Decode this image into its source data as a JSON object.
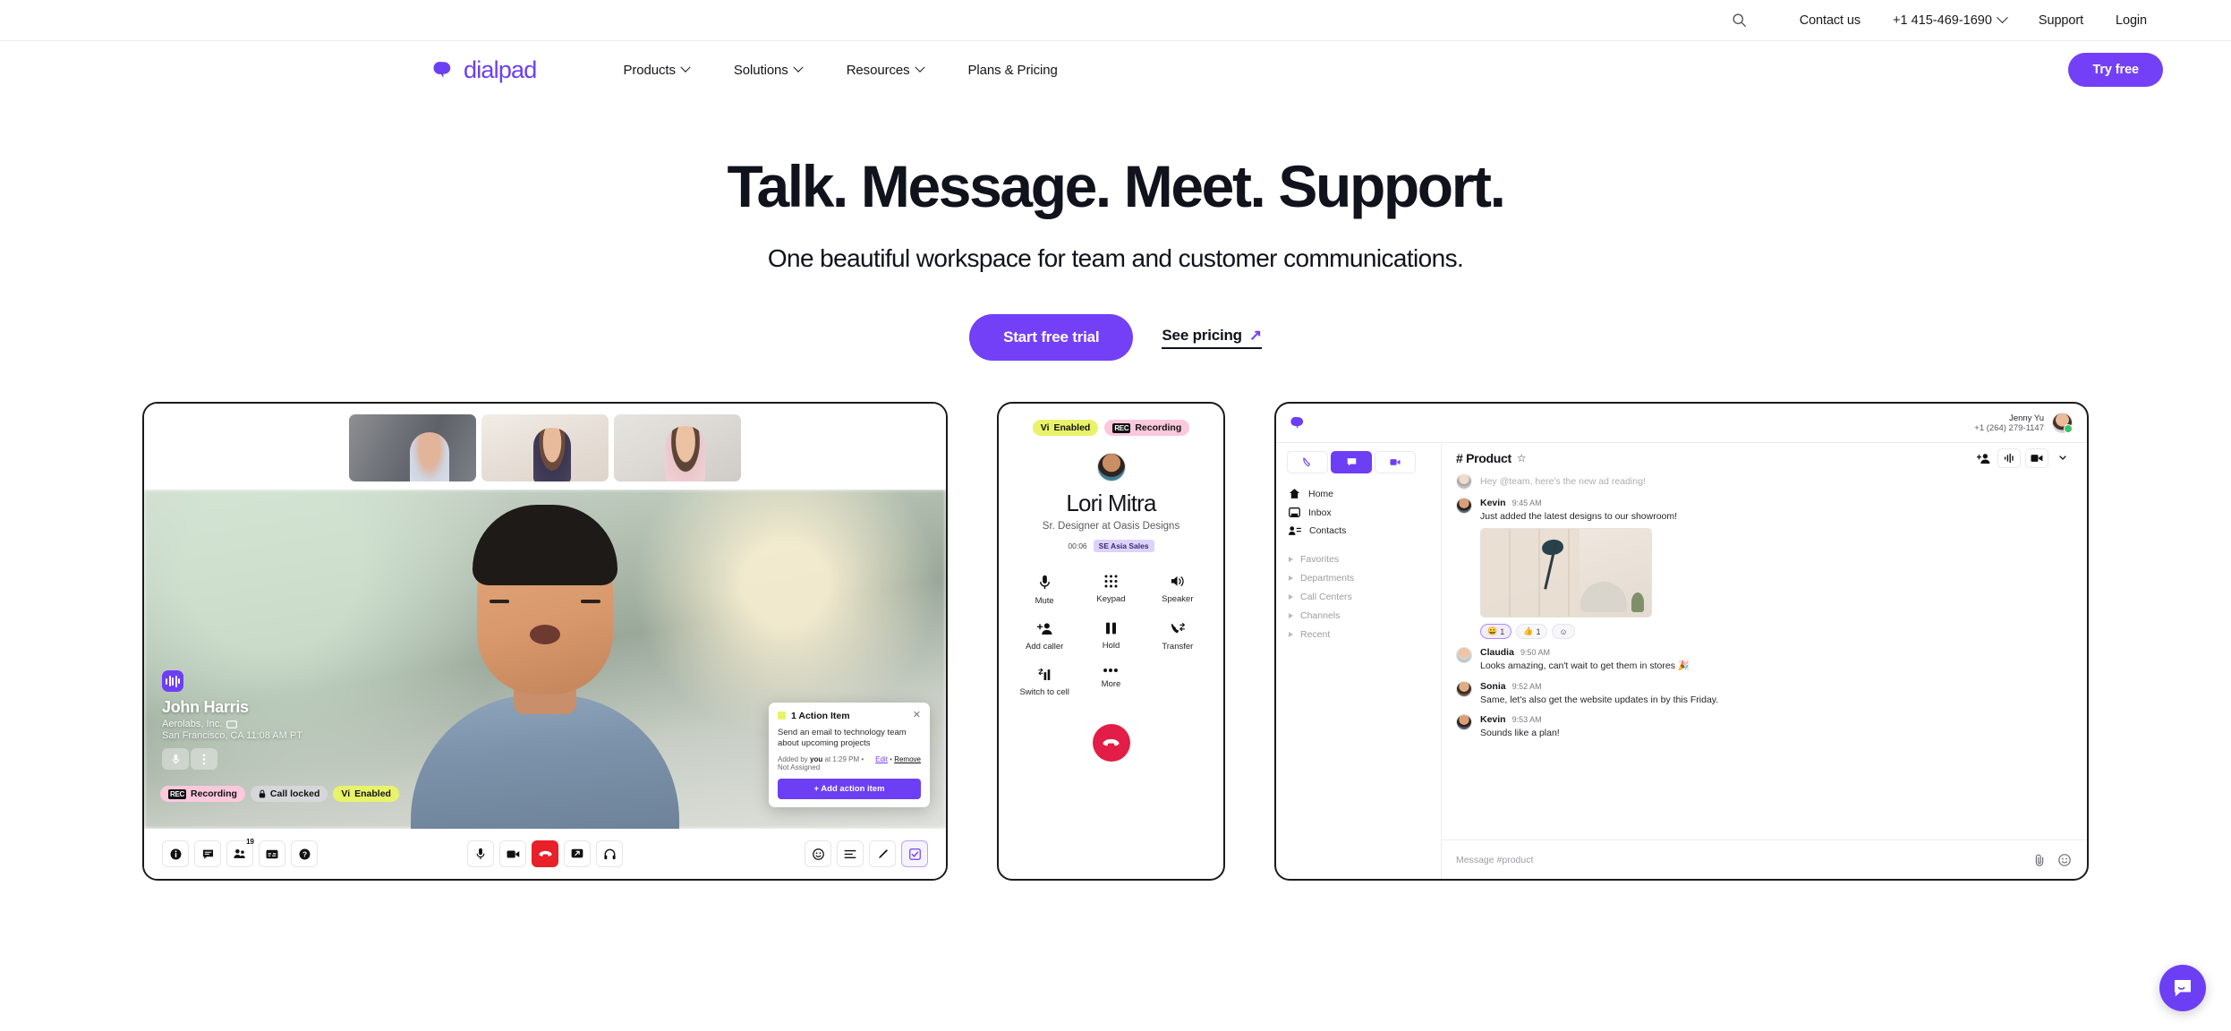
{
  "utility_bar": {
    "search_icon": "search-icon",
    "links": [
      {
        "label": "Contact us"
      },
      {
        "label": "Support"
      },
      {
        "label": "Login"
      }
    ],
    "phone": "+1 415-469-1690"
  },
  "nav": {
    "logo_text": "dialpad",
    "items": [
      {
        "label": "Products",
        "has_caret": true
      },
      {
        "label": "Solutions",
        "has_caret": true
      },
      {
        "label": "Resources",
        "has_caret": true
      },
      {
        "label": "Plans & Pricing",
        "has_caret": false
      }
    ],
    "cta": "Try free"
  },
  "hero": {
    "headline": "Talk. Message. Meet. Support.",
    "subhead": "One beautiful workspace for team and customer communications.",
    "primary_cta": "Start free trial",
    "secondary_cta": "See pricing",
    "secondary_arrow": "↗"
  },
  "meeting_card": {
    "participant_name": "John Harris",
    "participant_company": "Aerolabs, Inc.",
    "participant_location": "San Francisco, CA   11:08 AM PT",
    "badges": [
      {
        "label": "Recording",
        "icon": "REC",
        "color": "#fbc8dc"
      },
      {
        "label": "Call locked",
        "icon": "lock-icon",
        "color": "#d5d7da"
      },
      {
        "label": "Enabled",
        "icon": "Vi",
        "color": "#e9f36a"
      }
    ],
    "action_item": {
      "title": "1 Action Item",
      "text": "Send an email to technology team about upcoming projects",
      "meta_prefix": "Added by ",
      "meta_actor": "you",
      "meta_suffix": " at 1:29 PM • Not Assigned",
      "edit_label": "Edit",
      "separator": "•",
      "remove_label": "Remove",
      "add_button": "+ Add action item"
    },
    "toolbar_left": [
      {
        "name": "info-icon"
      },
      {
        "name": "chat-icon"
      },
      {
        "name": "participants-icon",
        "badge": "19"
      },
      {
        "name": "captions-icon"
      },
      {
        "name": "help-icon"
      }
    ],
    "toolbar_center": [
      {
        "name": "microphone-icon"
      },
      {
        "name": "video-camera-icon"
      },
      {
        "name": "end-call-icon",
        "danger": true
      },
      {
        "name": "screen-share-icon"
      },
      {
        "name": "headset-icon"
      }
    ],
    "toolbar_right": [
      {
        "name": "emoji-icon"
      },
      {
        "name": "transcript-icon"
      },
      {
        "name": "pen-icon"
      },
      {
        "name": "checklist-icon",
        "selected": true
      }
    ]
  },
  "phone_card": {
    "badges": [
      {
        "label": "Enabled",
        "icon": "Vi",
        "color": "#e9f36a"
      },
      {
        "label": "Recording",
        "icon": "REC",
        "color": "#fbc8dc"
      }
    ],
    "caller_name": "Lori Mitra",
    "caller_role": "Sr. Designer at Oasis Designs",
    "timer": "00:06",
    "line_tag": "SE Asia Sales",
    "controls": [
      {
        "label": "Mute",
        "icon": "microphone-icon"
      },
      {
        "label": "Keypad",
        "icon": "keypad-icon"
      },
      {
        "label": "Speaker",
        "icon": "speaker-icon"
      },
      {
        "label": "Add caller",
        "icon": "add-person-icon"
      },
      {
        "label": "Hold",
        "icon": "pause-icon"
      },
      {
        "label": "Transfer",
        "icon": "transfer-icon"
      },
      {
        "label": "Switch to cell",
        "icon": "switch-device-icon"
      },
      {
        "label": "More",
        "icon": "more-icon"
      }
    ],
    "end_call": "end-call-icon"
  },
  "chat_card": {
    "user_name": "Jenny Yu",
    "user_number": "+1 (264) 279-1147",
    "tabs": [
      {
        "name": "phone-tab",
        "icon": "phone-icon",
        "active": false
      },
      {
        "name": "message-tab",
        "icon": "message-icon",
        "active": true
      },
      {
        "name": "video-tab",
        "icon": "video-icon",
        "active": false
      }
    ],
    "sidebar_items": [
      {
        "label": "Home",
        "icon": "home-icon"
      },
      {
        "label": "Inbox",
        "icon": "inbox-icon"
      },
      {
        "label": "Contacts",
        "icon": "contacts-icon"
      }
    ],
    "sidebar_sections": [
      {
        "label": "Favorites"
      },
      {
        "label": "Departments"
      },
      {
        "label": "Call Centers"
      },
      {
        "label": "Channels"
      },
      {
        "label": "Recent"
      }
    ],
    "channel_name": "# Product",
    "channel_star": "☆",
    "channel_actions": [
      {
        "name": "add-member-icon"
      },
      {
        "name": "voice-icon"
      },
      {
        "name": "video-call-icon"
      },
      {
        "name": "chevron-down-icon"
      }
    ],
    "faded_message": {
      "text": "Hey @team, here's the new ad reading!"
    },
    "messages": [
      {
        "author": "Kevin",
        "time": "9:45 AM",
        "text": "Just added the latest designs to our showroom!",
        "has_image": true,
        "avatar": "av-kevin"
      },
      {
        "author": "Claudia",
        "time": "9:50 AM",
        "text": "Looks amazing, can't wait to get them in stores 🎉",
        "has_image": false,
        "avatar": "av-claudia"
      },
      {
        "author": "Sonia",
        "time": "9:52 AM",
        "text": "Same, let's also get the website updates in by this Friday.",
        "has_image": false,
        "avatar": "av-sonia"
      },
      {
        "author": "Kevin",
        "time": "9:53 AM",
        "text": "Sounds like a plan!",
        "has_image": false,
        "avatar": "av-kevin"
      }
    ],
    "reactions": [
      {
        "emoji": "😀",
        "count": "1",
        "active": true
      },
      {
        "emoji": "👍",
        "count": "1",
        "active": false
      },
      {
        "emoji": "☺",
        "count": "",
        "active": false
      }
    ],
    "composer_placeholder": "Message #product",
    "composer_icons": [
      {
        "name": "attachment-icon"
      },
      {
        "name": "emoji-icon"
      }
    ]
  },
  "intercom": {
    "name": "intercom-launcher"
  },
  "colors": {
    "accent": "#7340f7",
    "logo": "#6c3ff5",
    "danger": "#e8202a",
    "end_call": "#e11d48",
    "pill_yellow": "#e9f36a",
    "pill_pink": "#fbc8dc",
    "pill_gray": "#d5d7da"
  }
}
